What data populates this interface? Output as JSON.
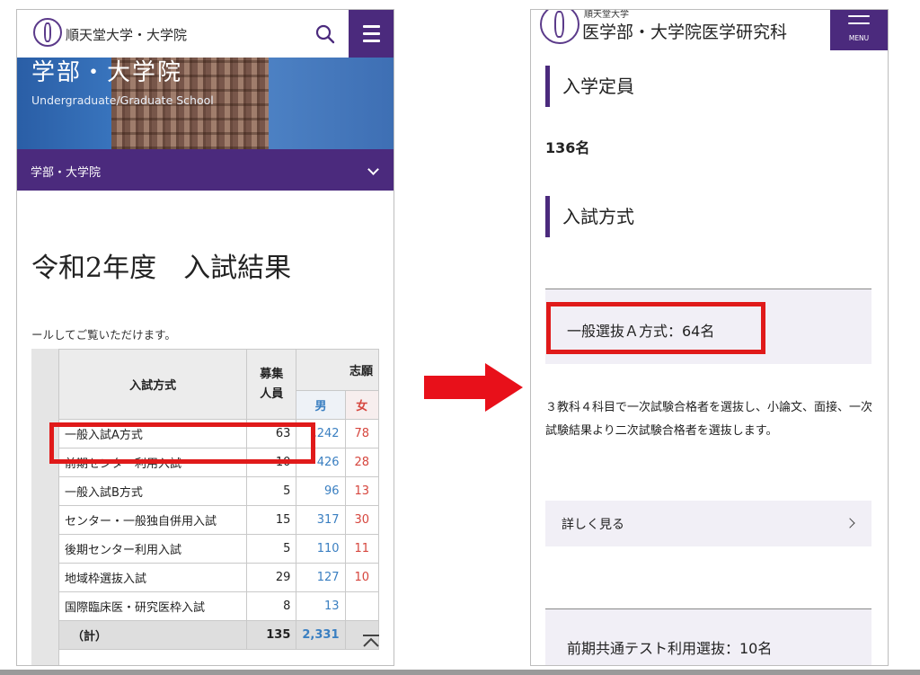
{
  "left": {
    "header": {
      "logo_text": "順天堂大学・大学院"
    },
    "hero": {
      "title": "学部・大学院",
      "subtitle": "Undergraduate/Graduate School"
    },
    "dropdown": {
      "label": "学部・大学院"
    },
    "page_title": "令和2年度　入試結果",
    "note": "ールしてご覧いただけます。",
    "table": {
      "headers": {
        "method": "入試方式",
        "quota": "募集人員",
        "applicants": "志願",
        "male": "男",
        "female": "女"
      },
      "rows": [
        {
          "method": "一般入試A方式",
          "quota": "63",
          "male": ",242",
          "female": "78"
        },
        {
          "method": "前期センター利用入試",
          "quota": "10",
          "male": "426",
          "female": "28"
        },
        {
          "method": "一般入試B方式",
          "quota": "5",
          "male": "96",
          "female": "13"
        },
        {
          "method": "センター・一般独自併用入試",
          "quota": "15",
          "male": "317",
          "female": "30"
        },
        {
          "method": "後期センター利用入試",
          "quota": "5",
          "male": "110",
          "female": "11"
        },
        {
          "method": "地域枠選抜入試",
          "quota": "29",
          "male": "127",
          "female": "10"
        },
        {
          "method": "国際臨床医・研究医枠入試",
          "quota": "8",
          "male": "13",
          "female": ""
        }
      ],
      "total": {
        "method": "（計）",
        "quota": "135",
        "male": "2,331",
        "female": ""
      }
    }
  },
  "right": {
    "header": {
      "logo_small": "順天堂大学",
      "logo_main": "医学部・大学院医学研究科",
      "menu_label": "MENU"
    },
    "section_capacity": {
      "heading": "入学定員",
      "value": "136名"
    },
    "section_method": {
      "heading": "入試方式"
    },
    "panel_general_a": {
      "title": "一般選抜Ａ方式：64名"
    },
    "description": "３教科４科目で一次試験合格者を選抜し、小論文、面接、一次試験結果より二次試験合格者を選抜します。",
    "more_link": {
      "label": "詳しく見る"
    },
    "panel_next": {
      "title": "前期共通テスト利用選抜：10名"
    }
  },
  "colors": {
    "purple": "#4b2a7d",
    "highlight_red": "#e01a1a",
    "arrow_red": "#e8101a",
    "male_blue": "#3a7fc1",
    "female_red": "#d6463e"
  }
}
